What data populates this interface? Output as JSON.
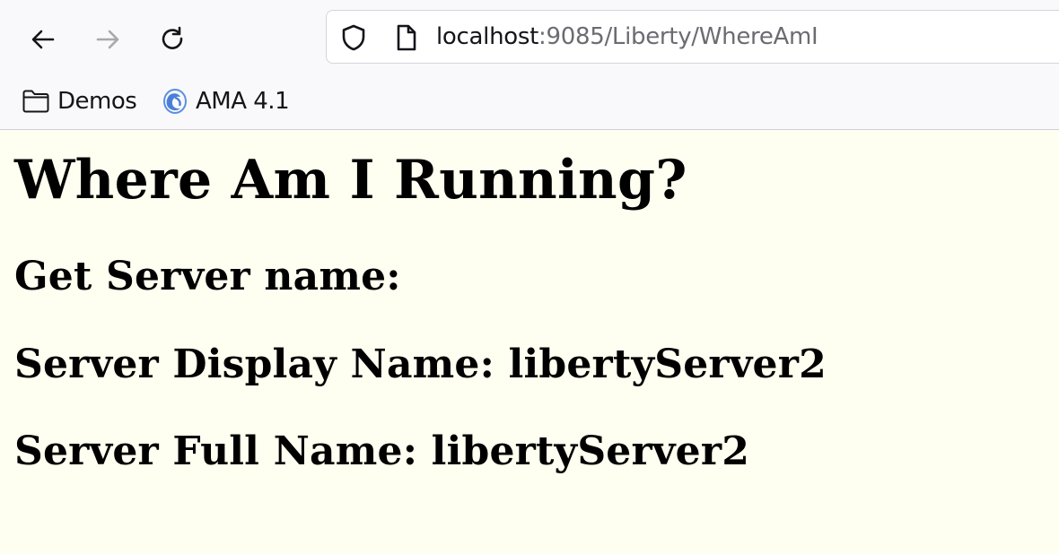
{
  "browser": {
    "url_host": "localhost",
    "url_rest": ":9085/Liberty/WhereAmI",
    "bookmarks": [
      {
        "label": "Demos",
        "icon": "folder-icon"
      },
      {
        "label": "AMA 4.1",
        "icon": "ama-favicon-icon"
      }
    ]
  },
  "page": {
    "title": "Where Am I Running?",
    "get_server_name": "Get Server name:",
    "server_display_name": "Server Display Name: libertyServer2",
    "server_full_name": "Server Full Name: libertyServer2"
  },
  "colors": {
    "page_background": "#fefff0",
    "chrome_background": "#f9f9fb",
    "url_secondary": "#6b6b72"
  }
}
